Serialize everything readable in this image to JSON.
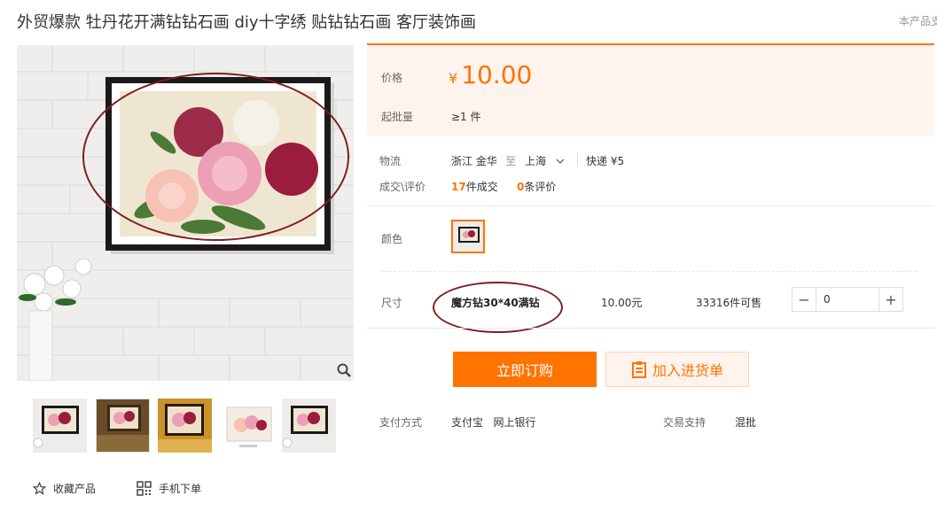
{
  "product": {
    "title": "外贸爆款 牡丹花开满钻钻石画 diy十字绣 贴钻钻石画 客厅装饰画",
    "side_note": "本产品支"
  },
  "gallery": {
    "actions": {
      "favorite": "收藏产品",
      "mobile_order": "手机下单"
    },
    "icons": [
      "zoom-icon",
      "star-icon",
      "qrcode-icon"
    ]
  },
  "price_box": {
    "price_label": "价格",
    "currency": "¥",
    "price": "10.00",
    "moq_label": "起批量",
    "moq_value": "≥1 件"
  },
  "logistics": {
    "label": "物流",
    "from": "浙江 金华",
    "to_word": "至",
    "dest": "上海",
    "shipping": "快递 ¥5"
  },
  "deals": {
    "label": "成交\\评价",
    "count": "17",
    "count_suffix": "件成交",
    "reviews": "0",
    "reviews_suffix": "条评价"
  },
  "color": {
    "label": "颜色"
  },
  "size": {
    "label": "尺寸",
    "option": "魔方钻30*40满钻",
    "price": "10.00元",
    "stock": "33316件可售",
    "qty": "0",
    "minus": "−",
    "plus": "+"
  },
  "buttons": {
    "buy": "立即订购",
    "cart": "加入进货单"
  },
  "payment": {
    "label": "支付方式",
    "methods": "支付宝   网上银行",
    "support_label": "交易支持",
    "support_value": "混批"
  },
  "colors": {
    "accent": "#ff7300",
    "price_bg": "#fff4ed",
    "annotation": "#7a1f1f"
  }
}
